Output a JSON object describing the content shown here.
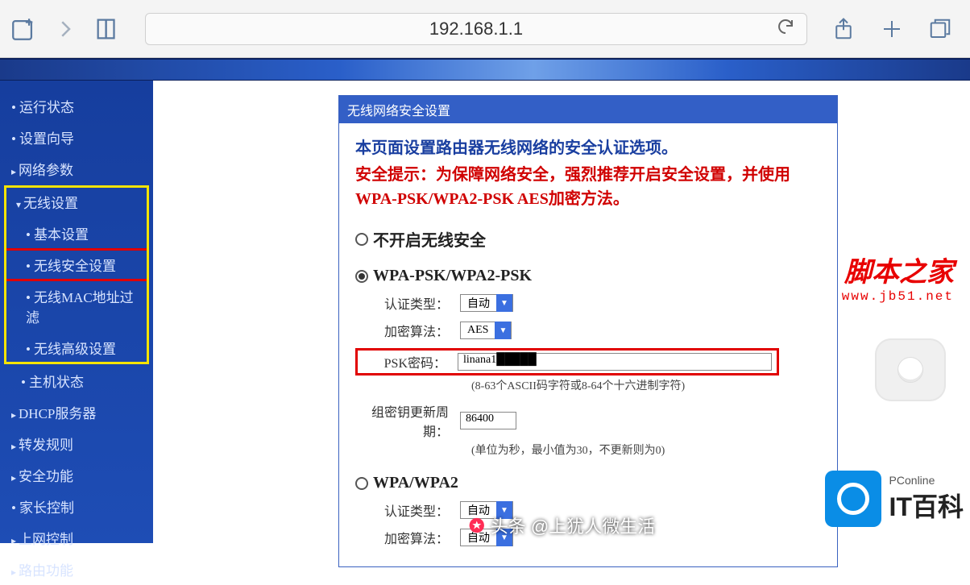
{
  "toolbar": {
    "url": "192.168.1.1"
  },
  "sidebar": {
    "items": [
      {
        "label": "运行状态",
        "kind": "bullet"
      },
      {
        "label": "设置向导",
        "kind": "bullet"
      },
      {
        "label": "网络参数",
        "kind": "parent"
      },
      {
        "label": "无线设置",
        "kind": "parentdown"
      },
      {
        "label": "基本设置",
        "kind": "sub"
      },
      {
        "label": "无线安全设置",
        "kind": "sub"
      },
      {
        "label": "无线MAC地址过滤",
        "kind": "sub"
      },
      {
        "label": "无线高级设置",
        "kind": "sub"
      },
      {
        "label": "主机状态",
        "kind": "sub"
      },
      {
        "label": "DHCP服务器",
        "kind": "parent"
      },
      {
        "label": "转发规则",
        "kind": "parent"
      },
      {
        "label": "安全功能",
        "kind": "parent"
      },
      {
        "label": "家长控制",
        "kind": "bullet"
      },
      {
        "label": "上网控制",
        "kind": "parent"
      },
      {
        "label": "路由功能",
        "kind": "parent"
      }
    ]
  },
  "panel": {
    "title": "无线网络安全设置",
    "intro_main": "本页面设置路由器无线网络的安全认证选项。",
    "intro_warn": "安全提示：为保障网络安全，强烈推荐开启安全设置，并使用WPA-PSK/WPA2-PSK AES加密方法。",
    "opt_none": "不开启无线安全",
    "opt_wpa_psk": "WPA-PSK/WPA2-PSK",
    "opt_wpa": "WPA/WPA2",
    "lbl_auth": "认证类型：",
    "lbl_enc": "加密算法：",
    "lbl_psk": "PSK密码：",
    "lbl_gkey": "组密钥更新周期：",
    "val_auto": "自动",
    "val_aes": "AES",
    "val_psk": "linana1█████",
    "val_gkey": "86400",
    "hint_psk": "(8-63个ASCII码字符或8-64个十六进制字符)",
    "hint_gkey": "(单位为秒，最小值为30，不更新则为0)"
  },
  "watermarks": {
    "jb51_cn": "脚本之家",
    "jb51_url": "www.jb51.net",
    "pconline_small": "PConline",
    "pconline_big": "IT百科",
    "author": "头条 @上犹人微生活"
  }
}
